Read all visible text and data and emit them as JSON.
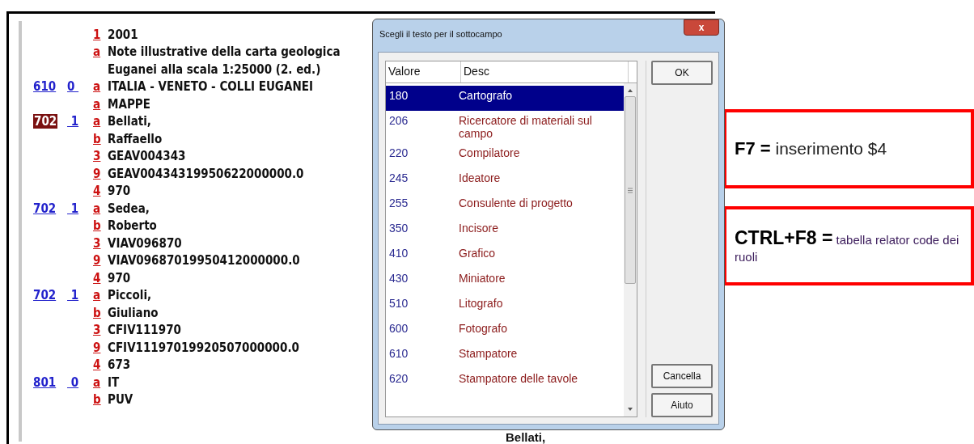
{
  "record": {
    "fields": [
      {
        "subfields": [
          {
            "code": "1",
            "lines": [
              "2001"
            ]
          },
          {
            "code": "a",
            "lines": [
              "Note illustrative della carta geologica",
              "Euganei alla scala 1:25000 (2. ed.)"
            ]
          }
        ]
      },
      {
        "tag": "610",
        "indicators": "0 ",
        "selected": false,
        "subfields": [
          {
            "code": "a",
            "lines": [
              "ITALIA - VENETO - COLLI EUGANEI"
            ]
          },
          {
            "code": "a",
            "lines": [
              "MAPPE"
            ]
          }
        ]
      },
      {
        "tag": "702",
        "indicators": " 1",
        "selected": true,
        "subfields": [
          {
            "code": "a",
            "lines": [
              "Bellati,"
            ]
          },
          {
            "code": "b",
            "lines": [
              "Raffaello"
            ]
          },
          {
            "code": "3",
            "lines": [
              "GEAV004343"
            ]
          },
          {
            "code": "9",
            "lines": [
              "GEAV00434319950622000000.0"
            ]
          },
          {
            "code": "4",
            "lines": [
              "970"
            ]
          }
        ]
      },
      {
        "tag": "702",
        "indicators": " 1",
        "selected": false,
        "subfields": [
          {
            "code": "a",
            "lines": [
              "Sedea,"
            ]
          },
          {
            "code": "b",
            "lines": [
              "Roberto"
            ]
          },
          {
            "code": "3",
            "lines": [
              "VIAV096870"
            ]
          },
          {
            "code": "9",
            "lines": [
              "VIAV09687019950412000000.0"
            ]
          },
          {
            "code": "4",
            "lines": [
              "970"
            ]
          }
        ]
      },
      {
        "tag": "702",
        "indicators": " 1",
        "selected": false,
        "subfields": [
          {
            "code": "a",
            "lines": [
              "Piccoli,"
            ]
          },
          {
            "code": "b",
            "lines": [
              "Giuliano"
            ]
          },
          {
            "code": "3",
            "lines": [
              "CFIV111970"
            ]
          },
          {
            "code": "9",
            "lines": [
              "CFIV11197019920507000000.0"
            ]
          },
          {
            "code": "4",
            "lines": [
              "673"
            ]
          }
        ]
      },
      {
        "tag": "801",
        "indicators": " 0",
        "selected": false,
        "subfields": [
          {
            "code": "a",
            "lines": [
              "IT"
            ]
          },
          {
            "code": "b",
            "lines": [
              "PUV"
            ]
          }
        ]
      }
    ],
    "hidden_text": "Bellati,"
  },
  "dialog": {
    "title": "Scegli il testo per il sottocampo",
    "close": "x",
    "columns": [
      "Valore",
      "Desc"
    ],
    "rows": [
      {
        "value": "180",
        "desc": "Cartografo",
        "selected": true
      },
      {
        "value": "206",
        "desc": "Ricercatore di materiali sul campo",
        "selected": false
      },
      {
        "value": "220",
        "desc": "Compilatore",
        "selected": false
      },
      {
        "value": "245",
        "desc": "Ideatore",
        "selected": false
      },
      {
        "value": "255",
        "desc": "Consulente di progetto",
        "selected": false
      },
      {
        "value": "350",
        "desc": "Incisore",
        "selected": false
      },
      {
        "value": "410",
        "desc": "Grafico",
        "selected": false
      },
      {
        "value": "430",
        "desc": "Miniatore",
        "selected": false
      },
      {
        "value": "510",
        "desc": "Litografo",
        "selected": false
      },
      {
        "value": "600",
        "desc": "Fotografo",
        "selected": false
      },
      {
        "value": "610",
        "desc": "Stampatore",
        "selected": false
      },
      {
        "value": "620",
        "desc": "Stampatore delle tavole",
        "selected": false
      }
    ],
    "buttons": [
      {
        "label": "OK",
        "kind": "top"
      },
      {
        "label": "Cancella",
        "kind": "bottom"
      },
      {
        "label": "Aiuto",
        "kind": "bottom"
      }
    ]
  },
  "notes": [
    {
      "text": "**F7 =** inserimento $4",
      "kind": "large"
    },
    {
      "text": "**CTRL+F8 =** tabella relator code dei ruoli",
      "kind": "small"
    }
  ]
}
